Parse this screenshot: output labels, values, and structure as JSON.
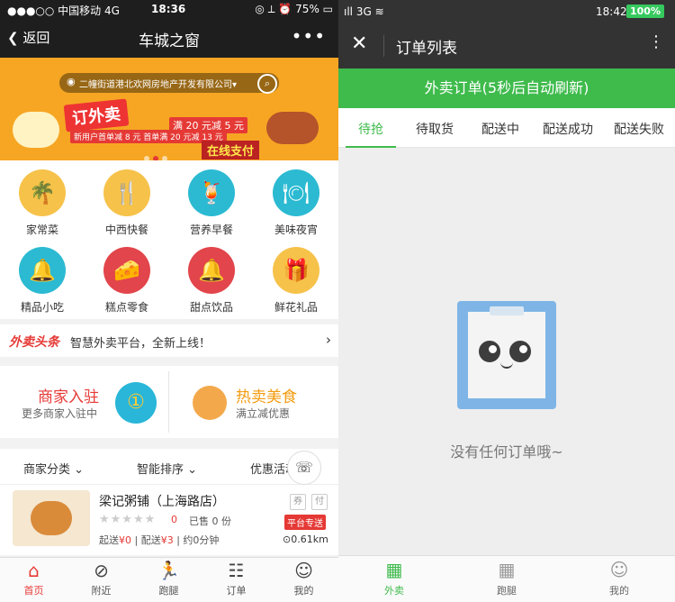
{
  "left": {
    "status": {
      "carrier": "●●●○○ 中国移动  4G",
      "time": "18:36",
      "battery": "◎ ⟂ ⏰ 75% ▭"
    },
    "nav": {
      "back": "❮ 返回",
      "title": "车城之窗",
      "more": "•••"
    },
    "banner": {
      "location": "二幢街道港北欢网房地产开发有限公司▾",
      "headline": "订外卖",
      "deal1": "满 20 元减 5 元",
      "deal2": "新用户首单减 8 元  首单满 20 元减 13 元",
      "pay": "在线支付"
    },
    "categories": [
      {
        "label": "家常菜",
        "color": "#f6c24a",
        "icon": "🌴"
      },
      {
        "label": "中西快餐",
        "color": "#f6c24a",
        "icon": "🍴"
      },
      {
        "label": "营养早餐",
        "color": "#2bbad2",
        "icon": "🍹"
      },
      {
        "label": "美味夜宵",
        "color": "#2bbad2",
        "icon": "🍽"
      },
      {
        "label": "精品小吃",
        "color": "#2bbad2",
        "icon": "🔔"
      },
      {
        "label": "糕点零食",
        "color": "#e2454b",
        "icon": "🧀"
      },
      {
        "label": "甜点饮品",
        "color": "#e2454b",
        "icon": "🔔"
      },
      {
        "label": "鲜花礼品",
        "color": "#f6c24a",
        "icon": "🎁"
      }
    ],
    "headline": {
      "logo": "外卖头条",
      "text": "智慧外卖平台，全新上线！"
    },
    "promos": {
      "merchant_title": "商家入驻",
      "merchant_sub": "更多商家入驻中",
      "hot_title": "热卖美食",
      "hot_sub": "满立减优惠"
    },
    "sort": {
      "category": "商家分类 ⌄",
      "smart": "智能排序 ⌄",
      "discount": "优惠活动"
    },
    "shop": {
      "name": "梁记粥铺（上海路店）",
      "stars": "★★★★★",
      "rating": "0",
      "sold": "已售 0 份",
      "meta_prefix": "起送",
      "min": "¥0",
      "fee_prefix": "配送",
      "fee": "¥3",
      "time": "约0分钟",
      "badge_coupon": "券",
      "badge_pay": "付",
      "platform": "平台专送",
      "distance": "⊙0.61km"
    },
    "tabs": [
      {
        "label": "首页",
        "icon": "⌂"
      },
      {
        "label": "附近",
        "icon": "⊘"
      },
      {
        "label": "跑腿",
        "icon": "🏃"
      },
      {
        "label": "订单",
        "icon": "☷"
      },
      {
        "label": "我的",
        "icon": "☺"
      }
    ]
  },
  "right": {
    "status": {
      "signal": "ıll 3G ≋",
      "time": "18:42",
      "battery": "100%"
    },
    "nav": {
      "close": "✕",
      "title": "订单列表",
      "more": "⋮"
    },
    "header": "外卖订单(5秒后自动刷新)",
    "tabs": [
      "待抢",
      "待取货",
      "配送中",
      "配送成功",
      "配送失败"
    ],
    "empty_text": "没有任何订单哦~",
    "bottom_tabs": [
      {
        "label": "外卖",
        "icon": "▦"
      },
      {
        "label": "跑腿",
        "icon": "▦"
      },
      {
        "label": "我的",
        "icon": "☺"
      }
    ],
    "accent": "#3fbb4c"
  }
}
